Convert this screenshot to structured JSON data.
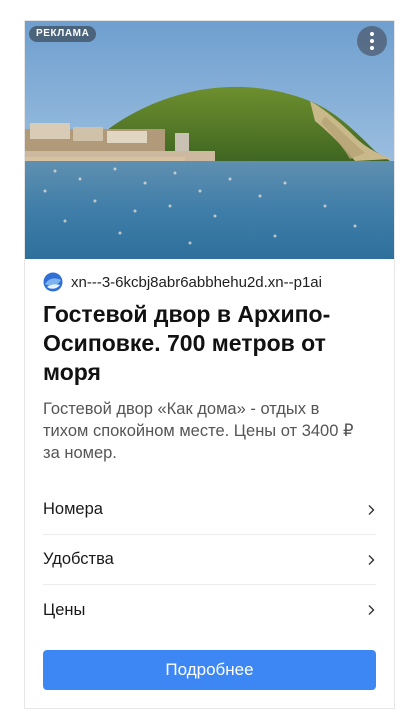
{
  "ad": {
    "badge": "РЕКЛАМА",
    "domain": "xn---3-6kcbj8abr6abbhehu2d.xn--p1ai",
    "title": "Гостевой двор в Архипо-Осиповке. 700 метров от моря",
    "description": "Гостевой двор «Как дома» - отдых в тихом спокойном месте. Цены от 3400 ₽ за номер.",
    "links": [
      {
        "label": "Номера"
      },
      {
        "label": "Удобства"
      },
      {
        "label": "Цены"
      }
    ],
    "cta_label": "Подробнее"
  },
  "colors": {
    "cta": "#3d87f5",
    "badge_bg": "#3c4b5a",
    "sea": "#3f7ea8",
    "hill": "#4f7a2a"
  },
  "icons": {
    "menu": "more-vertical-icon",
    "favicon": "site-favicon-icon",
    "chevron": "chevron-right-icon"
  }
}
